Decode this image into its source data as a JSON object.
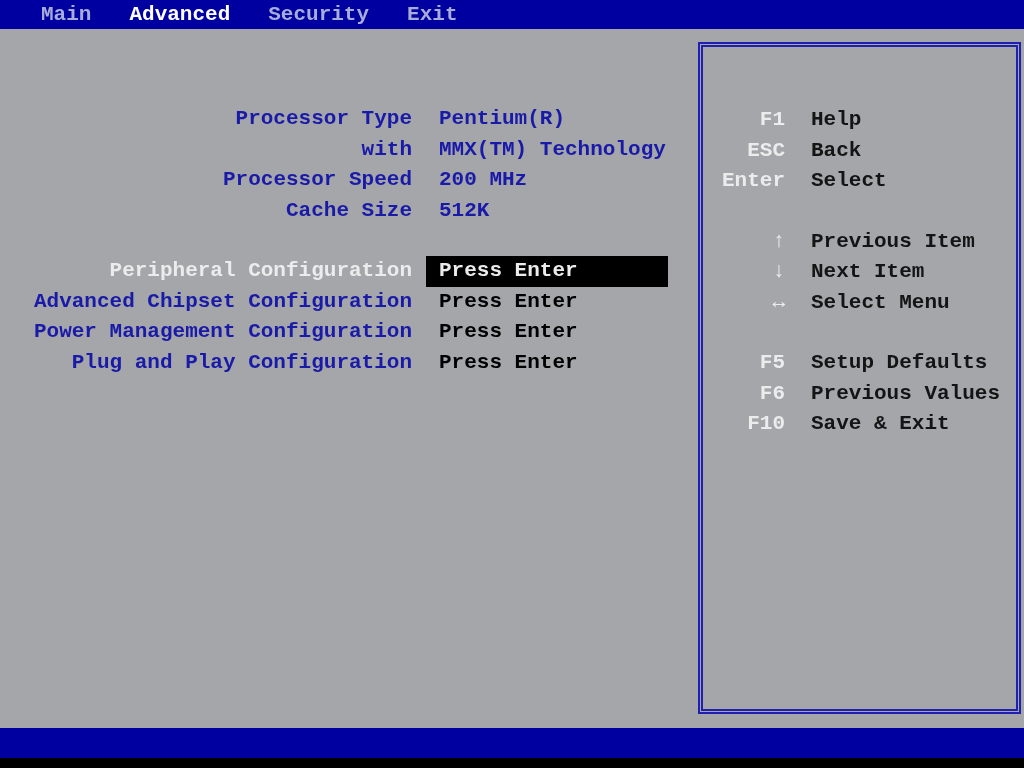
{
  "menu": [
    {
      "label": "Main",
      "selected": false
    },
    {
      "label": "Advanced",
      "selected": true
    },
    {
      "label": "Security",
      "selected": false
    },
    {
      "label": "Exit",
      "selected": false
    }
  ],
  "info": [
    {
      "label": "Processor Type",
      "value": "Pentium(R)"
    },
    {
      "label": "with",
      "value": "MMX(TM) Technology"
    },
    {
      "label": "Processor Speed",
      "value": "200 MHz"
    },
    {
      "label": "Cache Size",
      "value": "512K"
    }
  ],
  "submenus": [
    {
      "label": "Peripheral Configuration",
      "value": "Press Enter",
      "selected": true
    },
    {
      "label": "Advanced Chipset Configuration",
      "value": "Press Enter",
      "selected": false
    },
    {
      "label": "Power Management Configuration",
      "value": "Press Enter",
      "selected": false
    },
    {
      "label": "Plug and Play Configuration",
      "value": "Press Enter",
      "selected": false
    }
  ],
  "help": [
    [
      {
        "key": "F1",
        "action": "Help"
      },
      {
        "key": "ESC",
        "action": "Back"
      },
      {
        "key": "Enter",
        "action": "Select"
      }
    ],
    [
      {
        "key": "↑",
        "action": "Previous Item"
      },
      {
        "key": "↓",
        "action": "Next Item"
      },
      {
        "key": "↔",
        "action": "Select Menu"
      }
    ],
    [
      {
        "key": "F5",
        "action": "Setup Defaults"
      },
      {
        "key": "F6",
        "action": "Previous Values"
      },
      {
        "key": "F10",
        "action": "Save & Exit"
      }
    ]
  ]
}
